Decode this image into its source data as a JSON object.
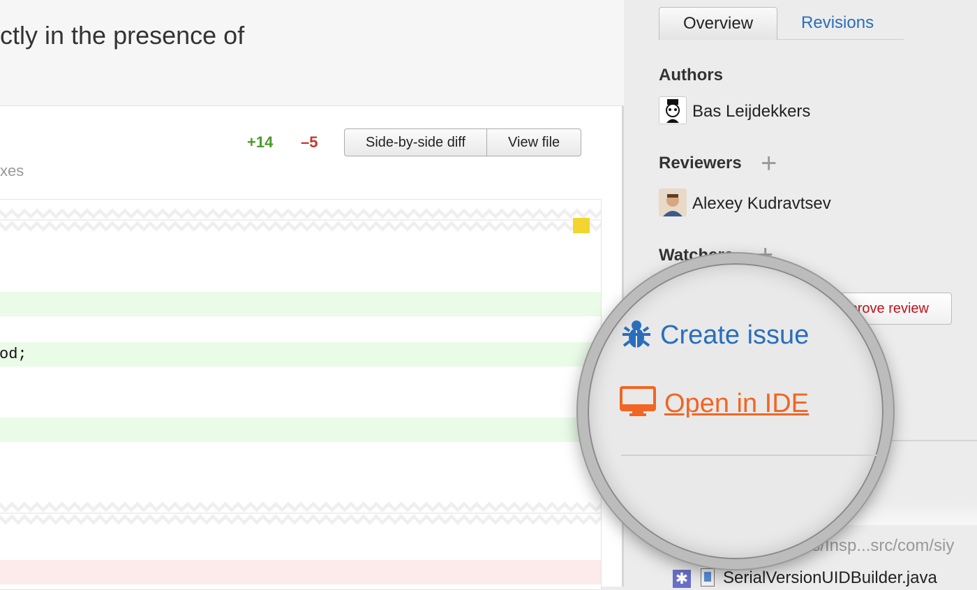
{
  "main": {
    "title": "ctly in the presence of",
    "additions": "+14",
    "deletions": "–5",
    "side_by_side_label": "Side-by-side diff",
    "view_file_label": "View file",
    "subtitle": "xes",
    "code_line": "od;"
  },
  "sidebar": {
    "tabs": [
      {
        "label": "Overview",
        "active": true
      },
      {
        "label": "Revisions",
        "active": false
      }
    ],
    "authors_heading": "Authors",
    "authors": [
      "Bas Leijdekkers"
    ],
    "reviewers_heading": "Reviewers",
    "reviewers": [
      "Alexey Kudravtsev"
    ],
    "watchers_heading": "Watchers",
    "approve_label": "Approve review",
    "path": "ns/Insp...src/com/siy",
    "file": "SerialVersionUIDBuilder.java"
  },
  "magnifier": {
    "create_issue": "Create issue",
    "open_in_ide": "Open in IDE",
    "colors": {
      "link_blue": "#2a6ebb",
      "ide_orange": "#f26522"
    }
  }
}
